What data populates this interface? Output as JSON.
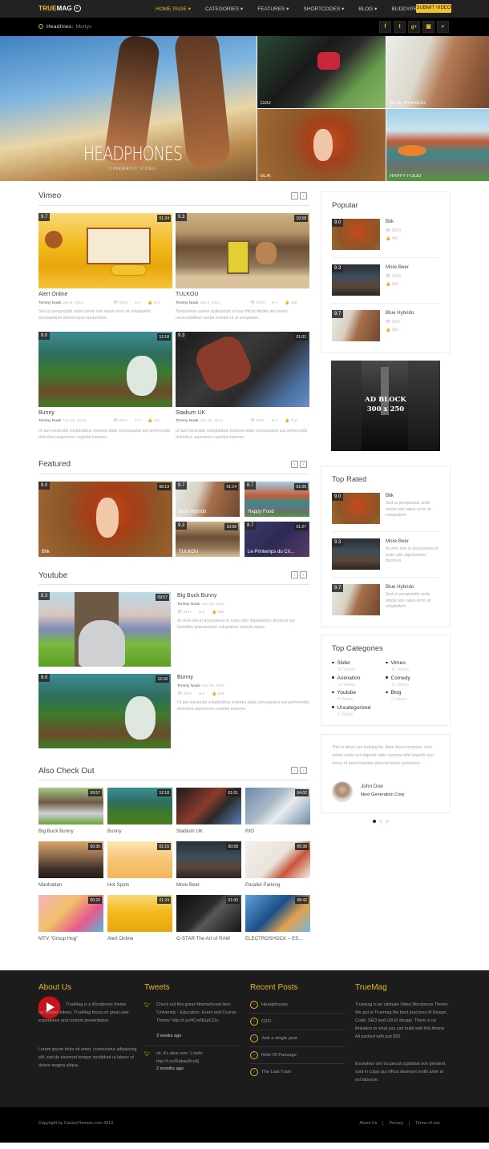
{
  "header": {
    "logo_a": "TRUE",
    "logo_b": "MAG",
    "nav": [
      "HOME PAGE ▾",
      "CATEGORIES ▾",
      "FEATURES ▾",
      "SHORTCODES ▾",
      "BLOG ▾",
      "BUDDYPRESS ▾"
    ],
    "submit_label": "SUBMIT VIDEO",
    "headlines_label": "Headlines:",
    "headlines_value": "Mortys",
    "social": [
      "f",
      "t",
      "g+",
      "yt",
      "search"
    ]
  },
  "hero": {
    "main_title": "HEADPHONES",
    "main_sub": "CINEMATIC VIDEO",
    "tiles": [
      "O2O",
      "BLUE HYBRIDO",
      "BLIK",
      "HAPPY FOOD"
    ]
  },
  "vimeo": {
    "title": "Vimeo",
    "items": [
      {
        "score": "9.7",
        "dur": "01:24",
        "title": "Alert Online",
        "author": "Tommy Noah",
        "date": "Jan 8, 2014",
        "views": "2020",
        "comments": "0",
        "likes": "224",
        "desc": "Sed ut perspiciatis unde omnis iste natus error sit voluptatem accusantium doloremque laudantium."
      },
      {
        "score": "9.3",
        "dur": "10:58",
        "title": "TULKOU",
        "author": "Tommy Noah",
        "date": "Jan 8, 2014",
        "views": "2070",
        "comments": "0",
        "likes": "188",
        "desc": "Temporibus autem quibusdam et aut officiis debitis aut rerum necessitatibus saepe eveniet ut et voluptates."
      },
      {
        "score": "9.0",
        "dur": "12:18",
        "title": "Bunny",
        "author": "Tommy Noah",
        "date": "Nov 26, 2013",
        "views": "2071",
        "comments": "0",
        "likes": "225",
        "desc": "Ut aut reiciendis voluptatibus maiores alias consequatur aut perferendis doloribus asperiores repellat maiores."
      },
      {
        "score": "9.3",
        "dur": "01:01",
        "title": "Stadium UK",
        "author": "Tommy Noah",
        "date": "Nov 26, 2013",
        "views": "2071",
        "comments": "0",
        "likes": "212",
        "desc": "Ut aut reiciendis voluptatibus maiores alias consequatur aut perferendis doloribus asperiores repellat maiores."
      }
    ]
  },
  "featured": {
    "title": "Featured",
    "items": [
      {
        "score": "9.0",
        "dur": "08:13",
        "title": "Blik"
      },
      {
        "score": "9.7",
        "dur": "01:14",
        "title": "Blue Hybrido"
      },
      {
        "score": "8.7",
        "dur": "01:06",
        "title": "Happy Food"
      },
      {
        "score": "9.3",
        "dur": "10:58",
        "title": "TULKOU"
      },
      {
        "score": "8.7",
        "dur": "01:27",
        "title": "Le Printemps du Cri..."
      }
    ]
  },
  "youtube": {
    "title": "Youtube",
    "items": [
      {
        "score": "8.3",
        "dur": "09:57",
        "title": "Big Buck Bunny",
        "author": "Tommy Noah",
        "date": "Nov 26, 2013",
        "views": "2147",
        "comments": "0",
        "likes": "256",
        "desc": "At vero eos et accusamus et iusto odio dignissimos ducimus qui blanditiis praesentium voluptatum deleniti atque."
      },
      {
        "score": "9.0",
        "dur": "12:18",
        "title": "Bunny",
        "author": "Tommy Noah",
        "date": "Nov 26, 2013",
        "views": "2071",
        "comments": "0",
        "likes": "225",
        "desc": "Ut aut reiciendis voluptatibus maiores alias consequatur aut perferendis doloribus asperiores repellat maiores."
      }
    ]
  },
  "also": {
    "title": "Also Check Out",
    "items": [
      {
        "dur": "09:57",
        "title": "Big Buck Bunny"
      },
      {
        "dur": "12:18",
        "title": "Bunny"
      },
      {
        "dur": "01:01",
        "title": "Stadium UK"
      },
      {
        "dur": "04:02",
        "title": "RIO"
      },
      {
        "dur": "00:36",
        "title": "Manhattan"
      },
      {
        "dur": "01:16",
        "title": "Hot Spots"
      },
      {
        "dur": "00:58",
        "title": "More Beer"
      },
      {
        "dur": "00:38",
        "title": "Parallel Parking"
      },
      {
        "dur": "00:20",
        "title": "MTV \"Group Hug\""
      },
      {
        "dur": "01:24",
        "title": "Alert Online"
      },
      {
        "dur": "01:00",
        "title": "G-STAR The Art of RAW"
      },
      {
        "dur": "08:42",
        "title": "ELECTROSHOCK – ES..."
      }
    ]
  },
  "sidebar": {
    "popular": {
      "title": "Popular",
      "items": [
        {
          "score": "9.0",
          "title": "Blik",
          "views": "3479",
          "likes": "403"
        },
        {
          "score": "9.3",
          "title": "More Beer",
          "views": "3100",
          "likes": "205"
        },
        {
          "score": "9.7",
          "title": "Blue Hybrido",
          "views": "3097",
          "likes": "183"
        }
      ]
    },
    "ad": {
      "line1": "AD BLOCK",
      "line2": "300 x 250"
    },
    "top_rated": {
      "title": "Top Rated",
      "items": [
        {
          "score": "9.0",
          "title": "Blik",
          "desc": "Sed ut perspiciatis unde omnis iste natus error sit voluptatem"
        },
        {
          "score": "9.3",
          "title": "More Beer",
          "desc": "At vero eos et accusamus et iusto odio dignissimos ducimus"
        },
        {
          "score": "9.7",
          "title": "Blue Hybrido",
          "desc": "Sed ut perspiciatis unde omnis iste natus error sit voluptatem"
        }
      ]
    },
    "categories": {
      "title": "Top Categories",
      "items": [
        {
          "name": "Slider",
          "count": "16 Videos"
        },
        {
          "name": "Vimeo",
          "count": "16 Videos"
        },
        {
          "name": "Animation",
          "count": "13 Videos"
        },
        {
          "name": "Comedy",
          "count": "11 Videos"
        },
        {
          "name": "Youtube",
          "count": "8 Videos"
        },
        {
          "name": "Blog",
          "count": "3 Videos"
        },
        {
          "name": "Uncategorized",
          "count": "1 Videos"
        }
      ]
    },
    "testimonial": {
      "text": "This is what i am looking for. Nam libero tempore, cum soluta nobis est eligendi optio cumque nihil impedit quo minus id quod maxime placeat facere possimus.",
      "name": "John Doe",
      "company": "Next Generation Corp"
    }
  },
  "footer": {
    "about_title": "About Us",
    "about_text1": "TrueMag is a Wordpress theme for hosted videos. TrueMag focus on great user experience and content presentation.",
    "about_text2": "Lorem ipsum dolor sit amet, consectetur adipisicing elit, sed do eiusmod tempor incididunt ut labore et dolore magna aliqua.",
    "tweets_title": "Tweets",
    "tweets": [
      {
        "text": "Check out this great #themeforest item 'University - Education, Event and Course Theme' http://t.co/4CmNGpC11c",
        "time": "3 weeks ago"
      },
      {
        "text": "ok, it's alive now :) visite http://t.co/RabayRcu6j",
        "time": "2 months ago"
      }
    ],
    "recent_title": "Recent Posts",
    "recent": [
      "Headphones",
      "O2O",
      "Just a single post",
      "Ride Of Passage",
      "The Last Train"
    ],
    "truemag_title": "TrueMag",
    "truemag_text1": "Truemag is an ultimate Video Wordpress Theme. We put in Truemag the best practices of Design, Code, SEO and UI/UX design. There is no limitation to what you can build with this theme. All packed with just $55.",
    "truemag_text2": "Excepteur sint occaecat cupidatat non proident, sunt in culpa qui officia deserunt mollit anim id est laborum.",
    "copyright": "Copyright by CactusThemes.com 2013",
    "links": [
      "About Us",
      "Privacy",
      "Terms of use"
    ]
  }
}
